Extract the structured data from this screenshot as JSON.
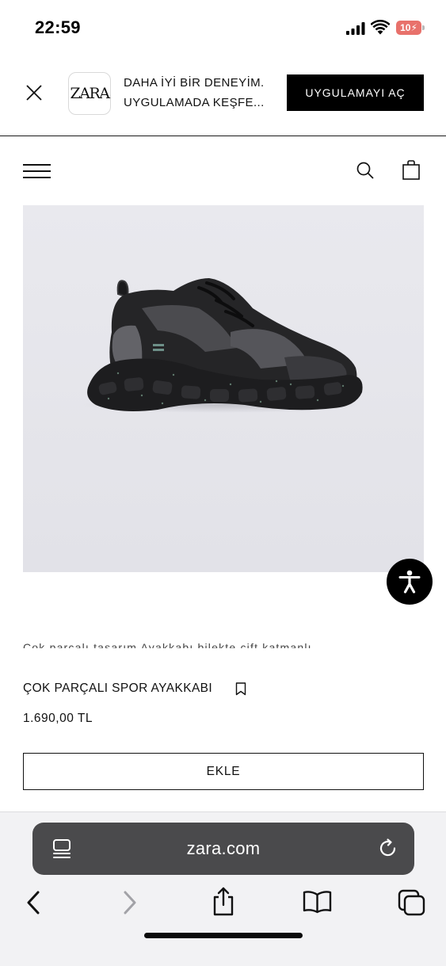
{
  "status_bar": {
    "time": "22:59",
    "battery_level": "10"
  },
  "app_banner": {
    "logo_text": "ZARA",
    "line1": "DAHA İYİ BİR DENEYİM.",
    "line2": "UYGULAMADA KEŞFE...",
    "cta_label": "UYGULAMAYI AÇ"
  },
  "product": {
    "description_clipped": "Çok parçalı tasarım Ayakkabı bilekte çift katmanlı",
    "name": "ÇOK PARÇALI SPOR AYAKKABI",
    "price": "1.690,00 TL",
    "add_label": "EKLE"
  },
  "browser": {
    "address": "zara.com"
  },
  "colors": {
    "banner_cta_bg": "#000000",
    "image_bg": "#e6e6eb",
    "address_bar_bg": "#4a4a4c",
    "toolbar_icon": "#1a6ff5",
    "toolbar_icon_disabled": "#9a9aa0"
  }
}
